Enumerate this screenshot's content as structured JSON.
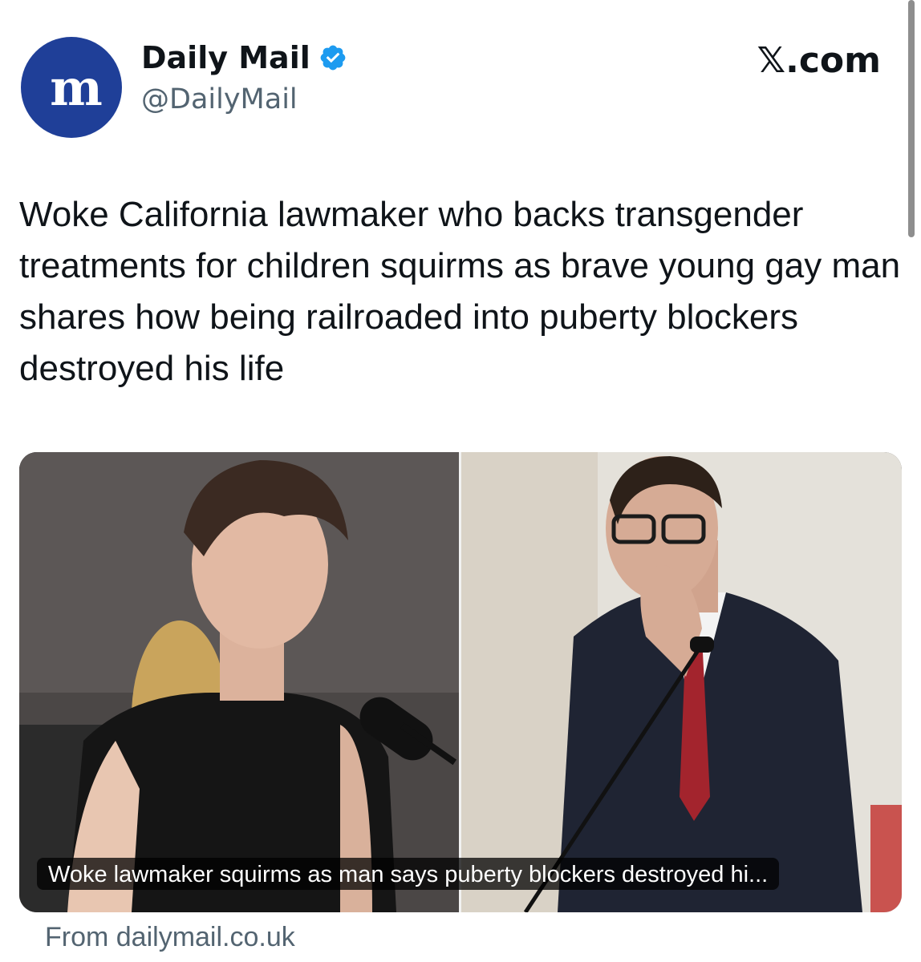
{
  "author": {
    "display_name": "Daily Mail",
    "handle": "@DailyMail",
    "avatar_logo_text": "M",
    "verified": true
  },
  "site_label": "𝕏.com",
  "tweet": {
    "text": "Woke California lawmaker who backs transgender treatments for children squirms as brave young gay man shares how being railroaded into puberty blockers destroyed his life"
  },
  "media": {
    "caption": "Woke lawmaker squirms as man says puberty blockers destroyed hi...",
    "source": "From dailymail.co.uk"
  },
  "colors": {
    "avatar_bg": "#1f3f98",
    "verified_badge": "#1d9bf0",
    "secondary_text": "#536471"
  },
  "icons": [
    "verified-badge-icon"
  ]
}
